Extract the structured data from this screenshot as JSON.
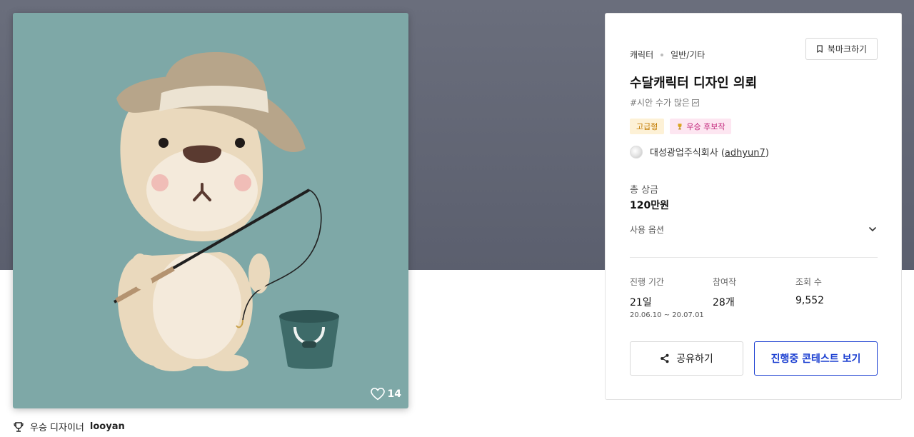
{
  "artwork": {
    "likes": "14",
    "heart_icon": "heart-outline-icon"
  },
  "winner": {
    "prefix": "우승 디자이너",
    "name": "looyan",
    "icon": "trophy-icon"
  },
  "contest": {
    "category": "캐릭터",
    "subcategory": "일반/기타",
    "bookmark_label": "북마크하기",
    "title": "수달캐릭터 디자인 의뢰",
    "tagline": "#시안 수가 많은",
    "badge_premium": "고급형",
    "badge_award": "우승 후보작",
    "host_name": "대성광업주식회사",
    "host_handle": "adhyun7",
    "prize_label": "총 상금",
    "prize_value": "120만원",
    "usage_label": "사용 옵션",
    "stats": {
      "period_label": "진행 기간",
      "period_value": "21일",
      "period_range": "20.06.10 ~ 20.07.01",
      "entries_label": "참여작",
      "entries_value": "28개",
      "views_label": "조회 수",
      "views_value": "9,552"
    },
    "share_label": "공유하기",
    "view_contest_label": "진행중 콘테스트 보기"
  },
  "colors": {
    "top_band": "#5f6372",
    "artwork_bg": "#7ea8a7",
    "primary_blue": "#1b3fd1",
    "premium_badge": "#c17a00",
    "award_badge": "#c2277c"
  }
}
